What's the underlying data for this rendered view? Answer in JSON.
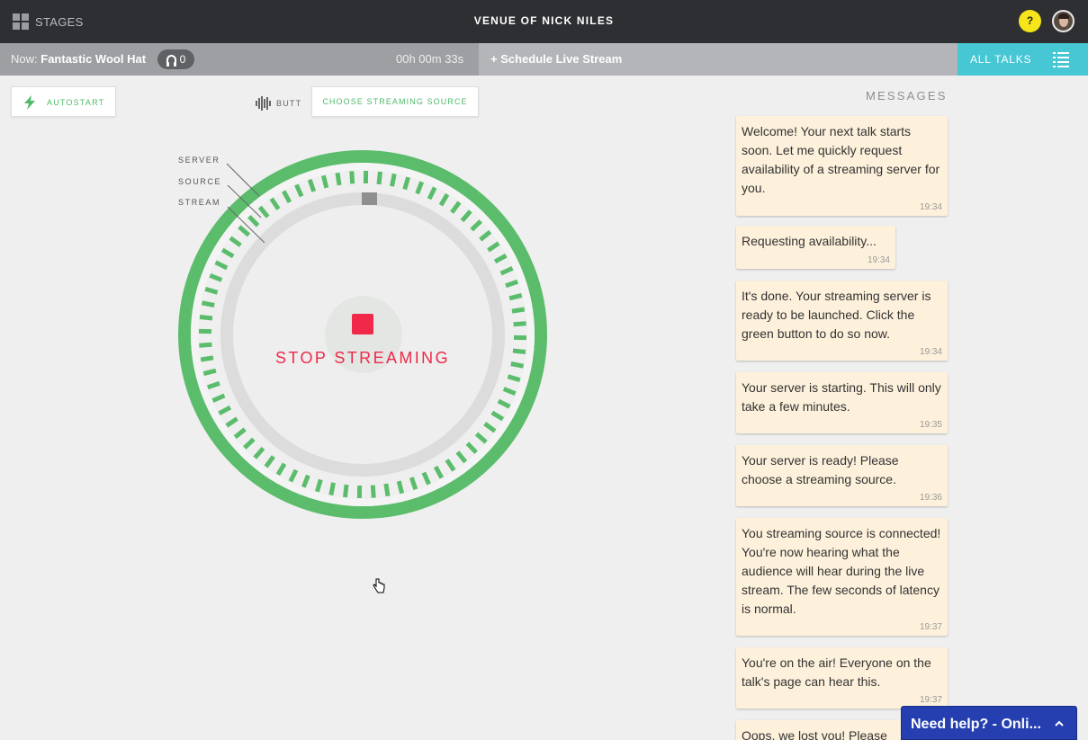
{
  "header": {
    "stages_label": "STAGES",
    "venue_title": "VENUE OF NICK NILES",
    "help_label": "?"
  },
  "nowbar": {
    "now_prefix": "Now:",
    "now_title": "Fantastic Wool Hat",
    "listener_count": "0",
    "elapsed": "00h 00m 33s",
    "schedule_label": "+ Schedule Live Stream",
    "all_talks_label": "ALL TALKS"
  },
  "controls": {
    "autostart_label": "AUTOSTART",
    "source_name": "BUTT",
    "choose_source_label": "CHOOSE STREAMING SOURCE"
  },
  "dial": {
    "labels": [
      "SERVER",
      "SOURCE",
      "STREAM"
    ],
    "stop_label": "STOP STREAMING",
    "colors": {
      "ring": "#5bbd6c",
      "track": "#dcdcdc",
      "stop": "#f0284a"
    }
  },
  "messages": {
    "title": "MESSAGES",
    "items": [
      {
        "text": "Welcome! Your next talk starts soon. Let me quickly request availability of a streaming server for you.",
        "time": "19:34"
      },
      {
        "text": "Requesting availability...",
        "time": "19:34"
      },
      {
        "text": "It's done. Your streaming server is ready to be launched. Click the green button to do so now.",
        "time": "19:34"
      },
      {
        "text": "Your server is starting. This will only take a few minutes.",
        "time": "19:35"
      },
      {
        "text": "Your server is ready! Please choose a streaming source.",
        "time": "19:36"
      },
      {
        "text": "You streaming source is connected! You're now hearing what the audience will hear during the live stream. The few seconds of latency is normal.",
        "time": "19:37"
      },
      {
        "text": "You're on the air! Everyone on the talk's page can hear this.",
        "time": "19:37"
      },
      {
        "text": "Oops, we lost you! Please",
        "time": ""
      }
    ]
  },
  "help_widget": {
    "label": "Need help? - Onli..."
  }
}
